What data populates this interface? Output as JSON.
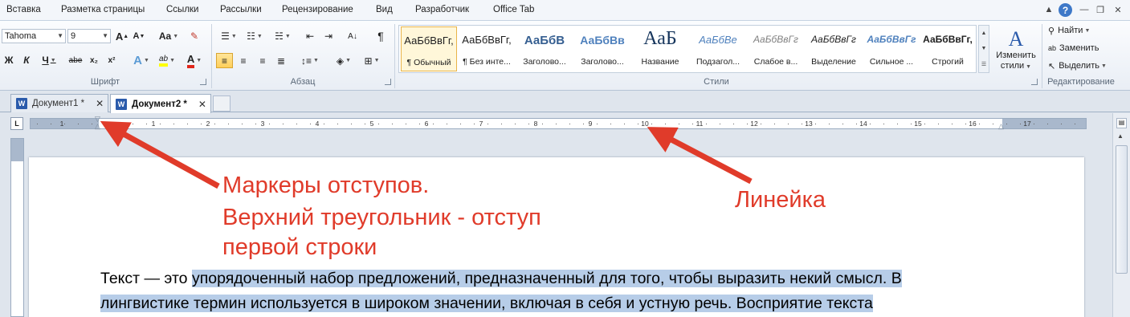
{
  "menu_tabs": [
    "Вставка",
    "Разметка страницы",
    "Ссылки",
    "Рассылки",
    "Рецензирование",
    "Вид",
    "Разработчик",
    "Office Tab"
  ],
  "help_label": "?",
  "font_group": {
    "font_name": "Tahoma",
    "font_size": "9",
    "grow_label": "A",
    "shrink_label": "A",
    "case_label": "Aa",
    "bold": "Ж",
    "italic": "К",
    "underline": "Ч",
    "strike": "abe",
    "subscript": "x₂",
    "superscript": "x²",
    "effects": "A",
    "highlight": "ab",
    "font_color": "A",
    "label": "Шрифт"
  },
  "paragraph_group": {
    "label": "Абзац",
    "pilcrow": "¶"
  },
  "styles_group": {
    "label": "Стили",
    "items": [
      {
        "sample": "АаБбВвГг,",
        "name": "¶ Обычный"
      },
      {
        "sample": "АаБбВвГг,",
        "name": "¶ Без инте..."
      },
      {
        "sample": "АаБбВ",
        "name": "Заголово..."
      },
      {
        "sample": "АаБбВв",
        "name": "Заголово..."
      },
      {
        "sample": "АаБ",
        "name": "Название"
      },
      {
        "sample": "АаБбВе",
        "name": "Подзагол..."
      },
      {
        "sample": "АаБбВвГг",
        "name": "Слабое в..."
      },
      {
        "sample": "АаБбВвГг",
        "name": "Выделение"
      },
      {
        "sample": "АаБбВвГг",
        "name": "Сильное ..."
      },
      {
        "sample": "АаБбВвГг,",
        "name": "Строгий"
      }
    ],
    "change_styles_line1": "Изменить",
    "change_styles_line2": "стили"
  },
  "editing_group": {
    "label": "Редактирование",
    "find": "Найти",
    "replace": "Заменить",
    "select": "Выделить"
  },
  "doc_tabs": [
    {
      "title": "Документ1 *"
    },
    {
      "title": "Документ2 *"
    }
  ],
  "tab_selector": "L",
  "ruler_numbers": [
    "1",
    "1",
    "2",
    "3",
    "4",
    "5",
    "6",
    "7",
    "8",
    "9",
    "10",
    "11",
    "12",
    "13",
    "14",
    "15",
    "16",
    "17"
  ],
  "annotations": {
    "markers_line1": "Маркеры отступов.",
    "markers_line2": "Верхний треугольник - отступ",
    "markers_line3": "первой строки",
    "ruler": "Линейка"
  },
  "document": {
    "line1_plain": "Текст — это ",
    "line1_selected": "упорядоченный набор предложений, предназначенный для того, чтобы выразить некий смысл. В",
    "line2_selected": "лингвистике термин используется в широком значении, включая в себя и устную речь. Восприятие текста"
  },
  "colors": {
    "annotation_red": "#e03b2a",
    "selection": "#b7cde8",
    "ribbon_bg": "#e9eef5",
    "word_blue": "#2b5bab"
  }
}
